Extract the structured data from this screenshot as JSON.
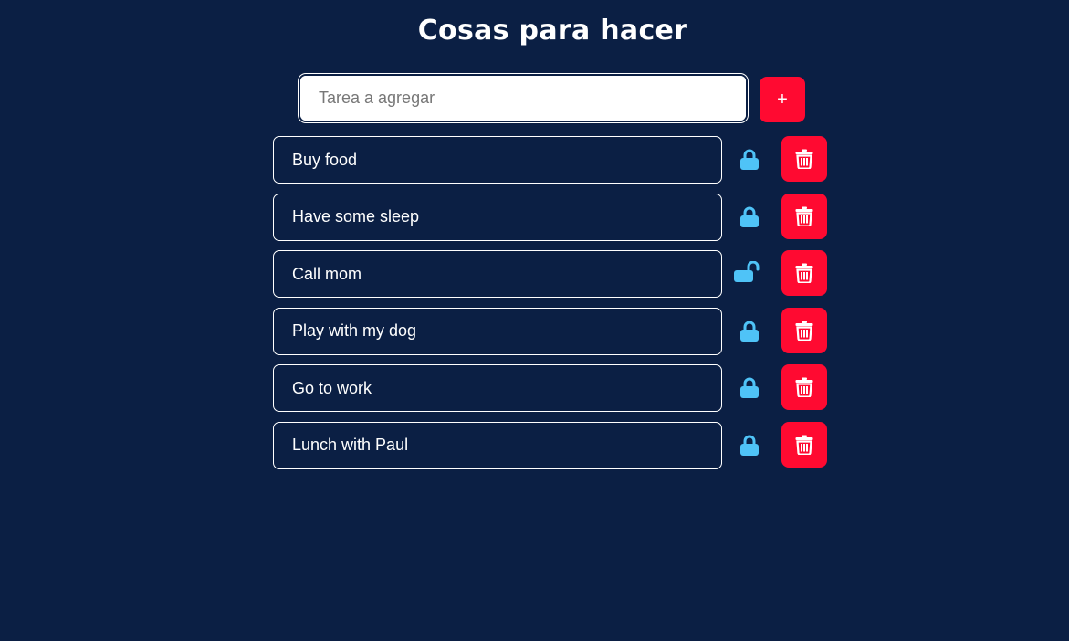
{
  "header": {
    "title": "Cosas para hacer"
  },
  "add_form": {
    "placeholder": "Tarea a agregar",
    "value": "",
    "add_label": "+"
  },
  "colors": {
    "background": "#0b1f44",
    "accent": "#ff0a31",
    "lock": "#4fc3f7",
    "text": "#ffffff"
  },
  "tasks": [
    {
      "text": "Buy food",
      "lock_icon": "lock-icon",
      "delete_icon": "trash-icon"
    },
    {
      "text": "Have some sleep",
      "lock_icon": "lock-icon",
      "delete_icon": "trash-icon"
    },
    {
      "text": "Call mom",
      "lock_icon": "unlock-icon",
      "delete_icon": "trash-icon"
    },
    {
      "text": "Play with my dog",
      "lock_icon": "lock-icon",
      "delete_icon": "trash-icon"
    },
    {
      "text": "Go to work",
      "lock_icon": "lock-icon",
      "delete_icon": "trash-icon"
    },
    {
      "text": "Lunch with Paul",
      "lock_icon": "lock-icon",
      "delete_icon": "trash-icon"
    }
  ]
}
